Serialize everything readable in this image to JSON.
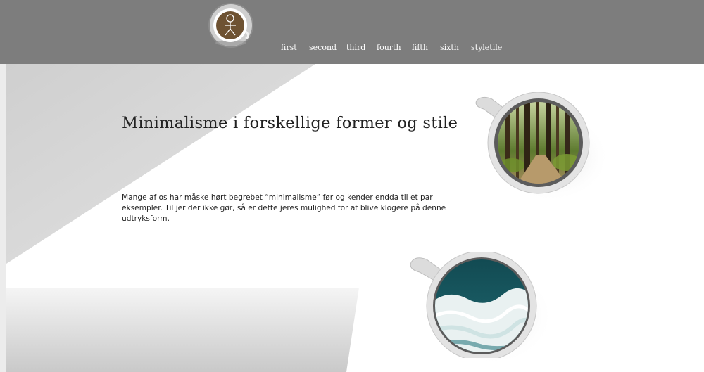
{
  "header": {
    "logo_icon": "cup-logo-icon",
    "nav": [
      "first",
      "second",
      "third",
      "fourth",
      "fifth",
      "sixth",
      "styletile"
    ]
  },
  "hero": {
    "title": "Minimalisme i forskellige former og stile",
    "intro": "Mange af os har måske hørt begrebet “minimalisme” før og kender endda til et par eksempler. Til jer der ikke gør, så er dette jeres mulighed for at blive klogere på denne udtryksform.",
    "images": [
      "forest-cup-image",
      "ocean-cup-image"
    ]
  },
  "colors": {
    "header_bg": "#7d7d7d",
    "nav_text": "#ffffff",
    "logo_brown": "#6e5232"
  }
}
